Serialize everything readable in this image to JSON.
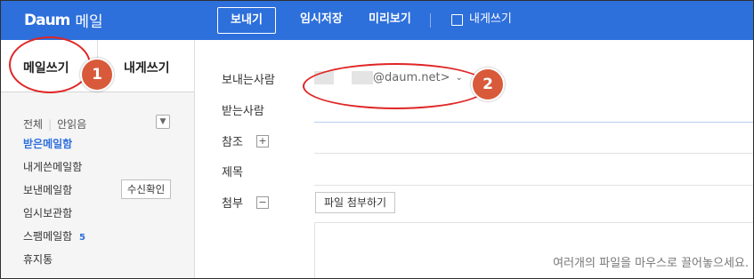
{
  "app": {
    "logo_brand": "Daum",
    "logo_text": "메일"
  },
  "toolbar": {
    "send_label": "보내기",
    "draft_label": "임시저장",
    "preview_label": "미리보기",
    "self_label": "내게쓰기"
  },
  "sidebar": {
    "tab_write": "메일쓰기",
    "tab_self": "내게쓰기",
    "filter_all": "전체",
    "filter_unread": "안읽음",
    "folders": [
      {
        "label": "받은메일함"
      },
      {
        "label": "내게쓴메일함"
      },
      {
        "label": "보낸메일함"
      },
      {
        "label": "임시보관함"
      },
      {
        "label": "스팸메일함",
        "count": "5"
      },
      {
        "label": "휴지통"
      }
    ],
    "confirm_label": "수신확인"
  },
  "form": {
    "sender_label": "보내는사람",
    "sender_domain": "@daum.net>",
    "recipient_label": "받는사람",
    "cc_label": "참조",
    "subject_label": "제목",
    "attach_label": "첨부",
    "attach_button": "파일 첨부하기",
    "dropzone_hint": "여러개의 파일을 마우스로 끌어놓으세요."
  },
  "annotations": {
    "badge1": "1",
    "badge2": "2",
    "ring_color": "#e02626",
    "badge_color": "#d85a3a"
  },
  "colors": {
    "brand": "#2d6fdb",
    "active_folder": "#2d6fdb"
  }
}
